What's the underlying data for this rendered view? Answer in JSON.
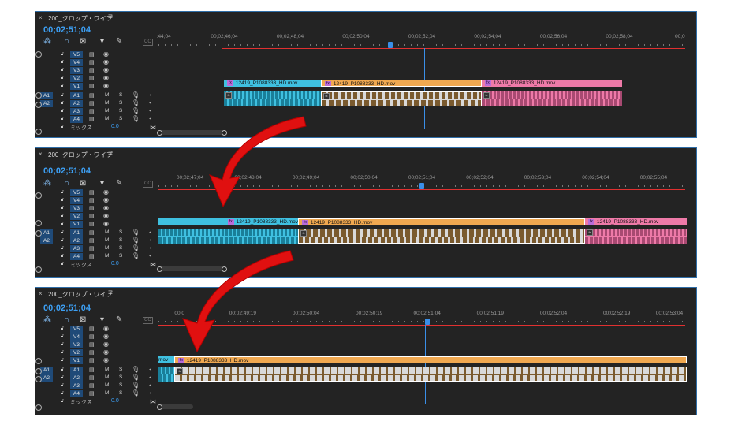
{
  "panels": [
    {
      "tab_title": "200_クロップ・ワイプ",
      "timecode": "00;02;51;04",
      "ruler_labels": [
        ":44;04",
        "00;02;46;04",
        "00;02;48;04",
        "00;02;50;04",
        "00;02;52;04",
        "00;02;54;04",
        "00;02;56;04",
        "00;02;58;04",
        "00;0"
      ],
      "clips": [
        {
          "label": "12419_P1088333_HD.mov",
          "color": "#3fc0e0"
        },
        {
          "label": "12419_P1088333_HD.mov",
          "color": "#f0a850"
        },
        {
          "label": "12419_P1088333_HD.mov",
          "color": "#ee7aa8"
        }
      ]
    },
    {
      "tab_title": "200_クロップ・ワイプ",
      "timecode": "00;02;51;04",
      "ruler_labels": [
        "00;02;47;04",
        "00;02;48;04",
        "00;02;49;04",
        "00;02;50;04",
        "00;02;51;04",
        "00;02;52;04",
        "00;02;53;04",
        "00;02;54;04",
        "00;02;55;04"
      ],
      "clips": [
        {
          "label": "12419_P1088333_HD.mov",
          "color": "#3fc0e0"
        },
        {
          "label": "12419_P1088333_HD.mov",
          "color": "#f0a850"
        },
        {
          "label": "12419_P1088333_HD.mov",
          "color": "#ee7aa8"
        }
      ]
    },
    {
      "tab_title": "200_クロップ・ワイプ",
      "timecode": "00;02;51;04",
      "ruler_labels": [
        "00;0",
        "00;02;49;19",
        "00;02;50;04",
        "00;02;50;19",
        "00;02;51;04",
        "00;02;51;19",
        "00;02;52;04",
        "00;02;52;19",
        "00;02;53;04"
      ],
      "clips": [
        {
          "label": "mov",
          "color": "#3fc0e0"
        },
        {
          "label": "12419_P1088333_HD.mov",
          "color": "#f0a850"
        }
      ]
    }
  ],
  "tracks": {
    "video": [
      "V5",
      "V4",
      "V3",
      "V2",
      "V1"
    ],
    "audio": [
      "A1",
      "A2",
      "A3",
      "A4"
    ],
    "source_audio": [
      "A1",
      "A2"
    ],
    "mute": "M",
    "solo": "S",
    "mix_label": "ミックス",
    "mix_value": "0.0",
    "cc": "CC"
  },
  "colors": {
    "accent_blue": "#3d9ff3",
    "arrow_red": "#e01010",
    "clip_cyan": "#3fc0e0",
    "clip_orange": "#f0a850",
    "clip_pink": "#ee7aa8",
    "fx_badge": "#b96cd8"
  },
  "icons": [
    "close-icon",
    "menu-icon",
    "ripple-icon",
    "magnet-icon",
    "linked-selection-icon",
    "marker-icon",
    "wrench-icon",
    "lock-icon",
    "film-icon",
    "eye-icon",
    "microphone-icon",
    "curved-arrow-icon"
  ]
}
